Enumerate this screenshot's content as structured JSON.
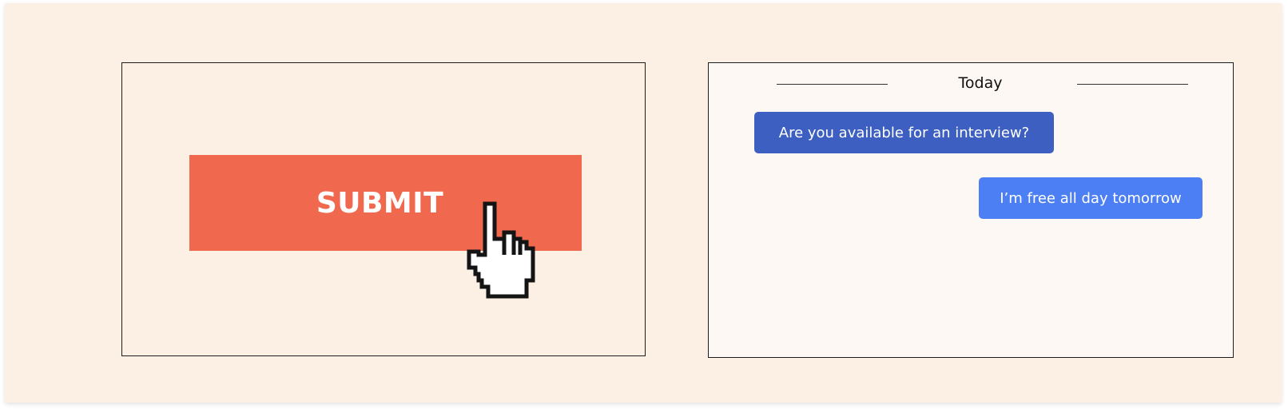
{
  "left_panel": {
    "submit_label": "SUBMIT",
    "button_color": "#f0694f",
    "cursor_icon": "hand-pointer-icon"
  },
  "chat": {
    "date_separator": "Today",
    "messages": [
      {
        "text": "Are you available for an interview?",
        "color": "#3c5fc1",
        "side": "left"
      },
      {
        "text": "I’m free all day tomorrow",
        "color": "#4d7ff4",
        "side": "right"
      }
    ]
  },
  "colors": {
    "background": "#fcefe4",
    "chat_background": "#fdf8f3"
  }
}
